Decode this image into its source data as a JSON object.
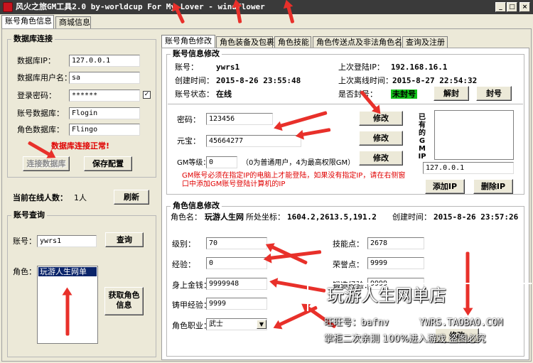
{
  "window": {
    "title": "风火之旅GM工具2.0   by-worldcup For My Lover - windflower",
    "minimize": "_",
    "maximize": "□",
    "close": "×"
  },
  "main_tabs": [
    {
      "label": "账号角色信息"
    },
    {
      "label": "商城信息"
    }
  ],
  "db": {
    "group_title": "数据库连接",
    "ip_label": "数据库IP：",
    "ip_value": "127.0.0.1",
    "user_label": "数据库用户名：",
    "user_value": "sa",
    "pass_label": "登录密码：",
    "pass_value": "******",
    "checkbox_mark": "✓",
    "account_db_label": "账号数据库：",
    "account_db_value": "Flogin",
    "role_db_label": "角色数据库：",
    "role_db_value": "Flingo",
    "status": "数据库连接正常!",
    "connect_btn": "连接数据库",
    "save_btn": "保存配置"
  },
  "online": {
    "label": "当前在线人数：",
    "value": "1人",
    "refresh_btn": "刷新"
  },
  "query": {
    "group_title": "账号查询",
    "account_label": "账号：",
    "account_value": "ywrs1",
    "query_btn": "查询",
    "role_label": "角色：",
    "roles": [
      "玩游人生网单"
    ],
    "fetch_btn_line1": "获取角色",
    "fetch_btn_line2": "信息"
  },
  "sub_tabs": [
    {
      "label": "账号角色修改"
    },
    {
      "label": "角色装备及包裹"
    },
    {
      "label": "角色技能"
    },
    {
      "label": "角色传送点及非法角色名"
    },
    {
      "label": "查询及注册"
    }
  ],
  "account": {
    "group_title": "账号信息修改",
    "acct_label": "账号：",
    "acct_value": "ywrs1",
    "last_ip_label": "上次登陆IP：",
    "last_ip_value": "192.168.16.1",
    "created_label": "创建时间：",
    "created_value": "2015-8-26 23:55:48",
    "last_logout_label": "上次离线时间：",
    "last_logout_value": "2015-8-27 22:54:32",
    "status_label": "账号状态：",
    "status_value": "在线",
    "banned_label": "是否封号：",
    "banned_value": "未封号",
    "unban_btn": "解封",
    "ban_btn": "封号",
    "password_label": "密码：",
    "password_value": "123456",
    "yuanbao_label": "元宝：",
    "yuanbao_value": "45664277",
    "gm_label": "GM等级：",
    "gm_value": "0",
    "gm_hint": "（0为普通用户，4为最高权限GM）",
    "modify_btn": "修改",
    "notice": "GM账号必须在指定IP的电脑上才能登陆，如果没有指定IP，请在右侧窗口中添加GM账号登陆计算机的IP",
    "gm_ip_title": "已有的GM IP",
    "gm_ip_input": "127.0.0.1",
    "add_ip_btn": "添加IP",
    "del_ip_btn": "删除IP"
  },
  "role": {
    "group_title": "角色信息修改",
    "name_label": "角色名：",
    "name_value": "玩游人生网",
    "coords_label": "所处坐标：",
    "coords_value": "1604.2,2613.5,191.2",
    "created_label": "创建时间：",
    "created_value": "2015-8-26 23:57:26",
    "level_label": "级别：",
    "level_value": "70",
    "skill_label": "技能点：",
    "skill_value": "2678",
    "exp_label": "经验：",
    "exp_value": "0",
    "honor_label": "荣誉点：",
    "honor_value": "9999",
    "gold_label": "身上金钱：",
    "gold_value": "9999948",
    "forge_label": "锻造经验：",
    "forge_value": "9999",
    "casting_label": "铸甲经验：",
    "casting_value": "9999",
    "job_label": "角色职业：",
    "job_value": "武士",
    "modify_btn": "修改"
  },
  "watermark": {
    "shop": "玩游人生网单店",
    "wangwang": "旺旺号：bafnv",
    "url": "YWRS.TAOBAO.COM",
    "slogan": "掌柜二次亲测 100%进入游戏 盗图必究"
  },
  "colors": {
    "title_bar": "#3a3a3a",
    "face": "#ece9d8",
    "status_red": "#e00000",
    "unbanned_green": "#13c21a",
    "arrow_red": "#e8302a",
    "selection": "#0a246a"
  }
}
